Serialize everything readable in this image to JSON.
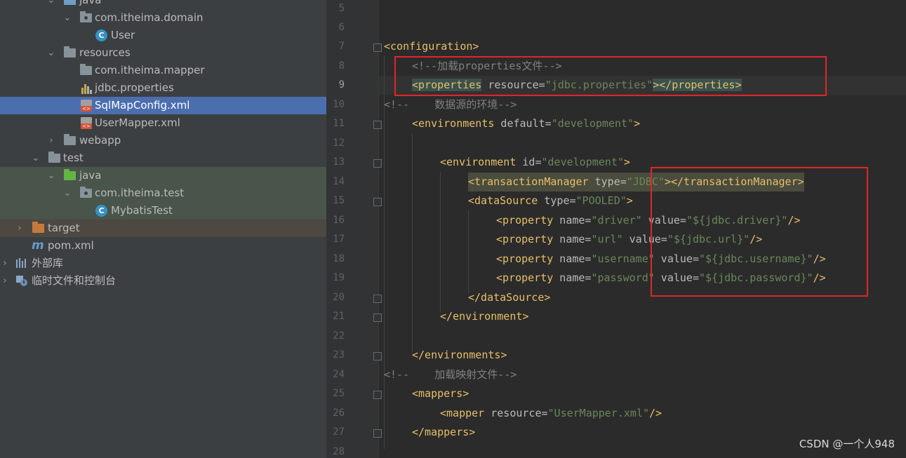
{
  "tree": {
    "items": [
      {
        "label": "java"
      },
      {
        "label": "com.itheima.domain"
      },
      {
        "label": "User"
      },
      {
        "label": "resources"
      },
      {
        "label": "com.itheima.mapper"
      },
      {
        "label": "jdbc.properties"
      },
      {
        "label": "SqlMapConfig.xml"
      },
      {
        "label": "UserMapper.xml"
      },
      {
        "label": "webapp"
      },
      {
        "label": "test"
      },
      {
        "label": "java"
      },
      {
        "label": "com.itheima.test"
      },
      {
        "label": "MybatisTest"
      },
      {
        "label": "target"
      },
      {
        "label": "pom.xml"
      },
      {
        "label": "外部库"
      },
      {
        "label": "临时文件和控制台"
      }
    ]
  },
  "editor": {
    "line_numbers": [
      "5",
      "6",
      "7",
      "8",
      "9",
      "10",
      "11",
      "12",
      "13",
      "14",
      "15",
      "16",
      "17",
      "18",
      "19",
      "20",
      "21",
      "22",
      "23",
      "24",
      "25",
      "26",
      "27",
      "28"
    ],
    "lines": {
      "l7_tag": "<configuration>",
      "l8_comment": "<!--加载properties文件-->",
      "l9_open": "<properties",
      "l9_attr": " resource=",
      "l9_val": "\"jdbc.properties\"",
      "l9_close": "></properties>",
      "l10_comment": "<!--    数据源的环境-->",
      "l11_open": "<environments",
      "l11_attr": " default=",
      "l11_val": "\"development\"",
      "l11_end": ">",
      "l13_open": "<environment",
      "l13_attr": " id=",
      "l13_val": "\"development\"",
      "l13_end": ">",
      "l14_open": "<transactionManager",
      "l14_attr": " type=",
      "l14_val": "\"JDBC\"",
      "l14_close": "></transactionManager>",
      "l15_open": "<dataSource",
      "l15_attr": " type=",
      "l15_val": "\"POOLED\"",
      "l15_end": ">",
      "l16_open": "<property",
      "l16_a1": " name=",
      "l16_v1": "\"driver\"",
      "l16_a2": " value=",
      "l16_v2": "\"${jdbc.driver}\"",
      "l16_end": "/>",
      "l17_open": "<property",
      "l17_a1": " name=",
      "l17_v1": "\"url\"",
      "l17_a2": " value=",
      "l17_v2": "\"${jdbc.url}\"",
      "l17_end": "/>",
      "l18_open": "<property",
      "l18_a1": " name=",
      "l18_v1": "\"username\"",
      "l18_a2": " value=",
      "l18_v2": "\"${jdbc.username}\"",
      "l18_end": "/>",
      "l19_open": "<property",
      "l19_a1": " name=",
      "l19_v1": "\"password\"",
      "l19_a2": " value=",
      "l19_v2": "\"${jdbc.password}\"",
      "l19_end": "/>",
      "l20_tag": "</dataSource>",
      "l21_tag": "</environment>",
      "l23_tag": "</environments>",
      "l24_comment": "<!--    加载映射文件-->",
      "l25_tag": "<mappers>",
      "l26_open": "<mapper",
      "l26_attr": " resource=",
      "l26_val": "\"UserMapper.xml\"",
      "l26_end": "/>",
      "l27_tag": "</mappers>"
    }
  },
  "watermark": "CSDN @一个人948",
  "colors": {
    "selection": "#4b6eaf",
    "tag": "#e8bf6a",
    "string": "#6a8759",
    "comment": "#808080",
    "annotation_box": "#e0262a"
  }
}
